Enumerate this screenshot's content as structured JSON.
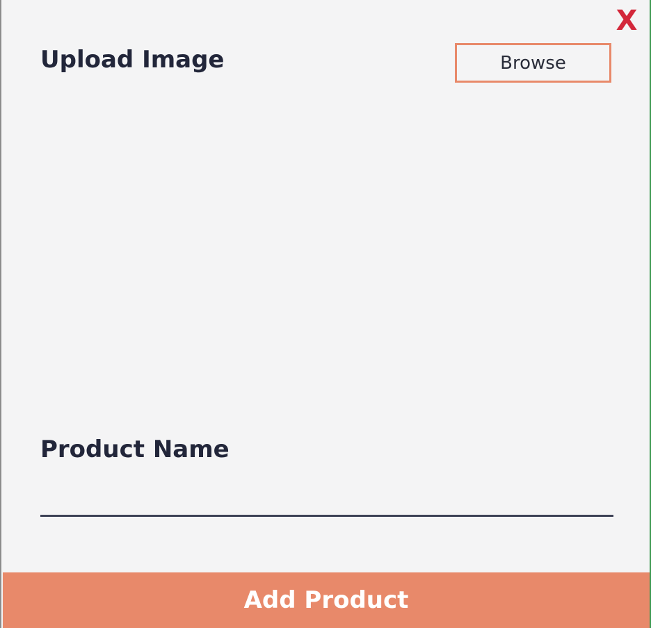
{
  "dialog": {
    "close_label": "X",
    "upload_title": "Upload Image",
    "browse_label": "Browse",
    "product_name_label": "Product Name",
    "product_name_value": "",
    "submit_label": "Add Product"
  },
  "colors": {
    "accent": "#e8896a",
    "close": "#d3283b",
    "text": "#22263a",
    "background": "#f4f4f5"
  }
}
